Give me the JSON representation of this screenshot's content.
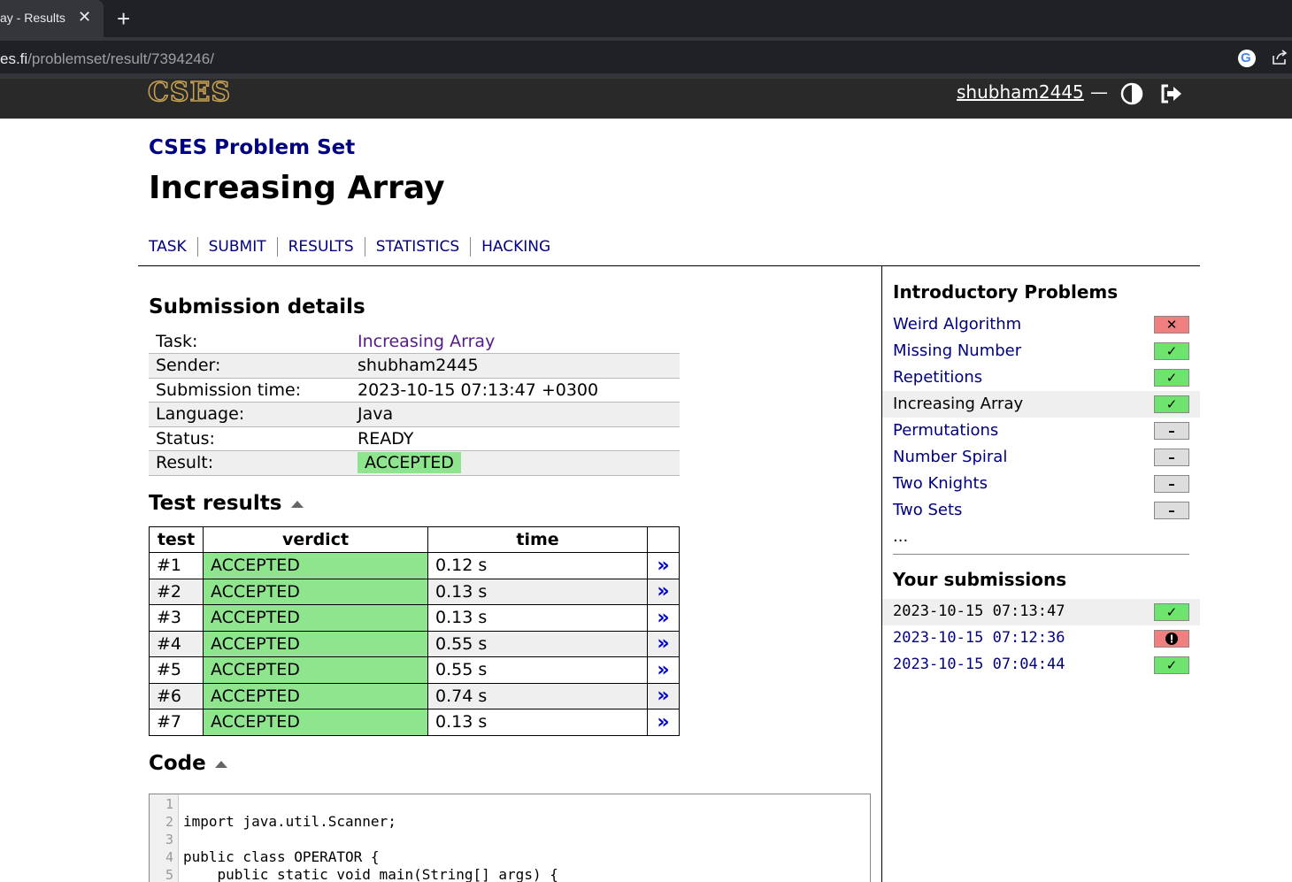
{
  "browser": {
    "tab_title": "ay - Results",
    "tab_close": "✕",
    "new_tab": "+",
    "url_host": "es.fi",
    "url_path": "/problemset/result/7394246/"
  },
  "site": {
    "logo": "CSES",
    "username": "shubham2445",
    "dash": "—"
  },
  "breadcrumb": "CSES Problem Set",
  "title": "Increasing Array",
  "nav": [
    "TASK",
    "SUBMIT",
    "RESULTS",
    "STATISTICS",
    "HACKING"
  ],
  "details": {
    "heading": "Submission details",
    "rows": [
      {
        "key": "Task:",
        "value": "Increasing Array"
      },
      {
        "key": "Sender:",
        "value": "shubham2445"
      },
      {
        "key": "Submission time:",
        "value": "2023-10-15 07:13:47 +0300"
      },
      {
        "key": "Language:",
        "value": "Java"
      },
      {
        "key": "Status:",
        "value": "READY"
      },
      {
        "key": "Result:",
        "value": "ACCEPTED"
      }
    ]
  },
  "tests": {
    "heading": "Test results",
    "columns": [
      "test",
      "verdict",
      "time",
      ""
    ],
    "rows": [
      {
        "test": "#1",
        "verdict": "ACCEPTED",
        "time": "0.12 s"
      },
      {
        "test": "#2",
        "verdict": "ACCEPTED",
        "time": "0.13 s"
      },
      {
        "test": "#3",
        "verdict": "ACCEPTED",
        "time": "0.13 s"
      },
      {
        "test": "#4",
        "verdict": "ACCEPTED",
        "time": "0.55 s"
      },
      {
        "test": "#5",
        "verdict": "ACCEPTED",
        "time": "0.55 s"
      },
      {
        "test": "#6",
        "verdict": "ACCEPTED",
        "time": "0.74 s"
      },
      {
        "test": "#7",
        "verdict": "ACCEPTED",
        "time": "0.13 s"
      }
    ],
    "link_label": "»"
  },
  "code": {
    "heading": "Code",
    "line_numbers": [
      "1",
      "2",
      "3",
      "4",
      "5"
    ],
    "lines": [
      "",
      "import java.util.Scanner;",
      "",
      "public class OPERATOR {",
      "    public static void main(String[] args) {"
    ]
  },
  "sidebar": {
    "problems_heading": "Introductory Problems",
    "problems": [
      {
        "label": "Weird Algorithm",
        "status": "fail",
        "symbol": "✕"
      },
      {
        "label": "Missing Number",
        "status": "ok",
        "symbol": "✓"
      },
      {
        "label": "Repetitions",
        "status": "ok",
        "symbol": "✓"
      },
      {
        "label": "Increasing Array",
        "status": "ok",
        "symbol": "✓",
        "current": true
      },
      {
        "label": "Permutations",
        "status": "none",
        "symbol": "–"
      },
      {
        "label": "Number Spiral",
        "status": "none",
        "symbol": "–"
      },
      {
        "label": "Two Knights",
        "status": "none",
        "symbol": "–"
      },
      {
        "label": "Two Sets",
        "status": "none",
        "symbol": "–"
      }
    ],
    "more": "...",
    "submissions_heading": "Your submissions",
    "submissions": [
      {
        "label": "2023-10-15 07:13:47",
        "status": "ok",
        "symbol": "✓",
        "current": true
      },
      {
        "label": "2023-10-15 07:12:36",
        "status": "err",
        "symbol": "!"
      },
      {
        "label": "2023-10-15 07:04:44",
        "status": "ok",
        "symbol": "✓"
      }
    ]
  },
  "colors": {
    "accent": "#000080",
    "accepted": "#8ee58e",
    "header_bg": "#292929",
    "logo_gold": "#c7a252"
  }
}
